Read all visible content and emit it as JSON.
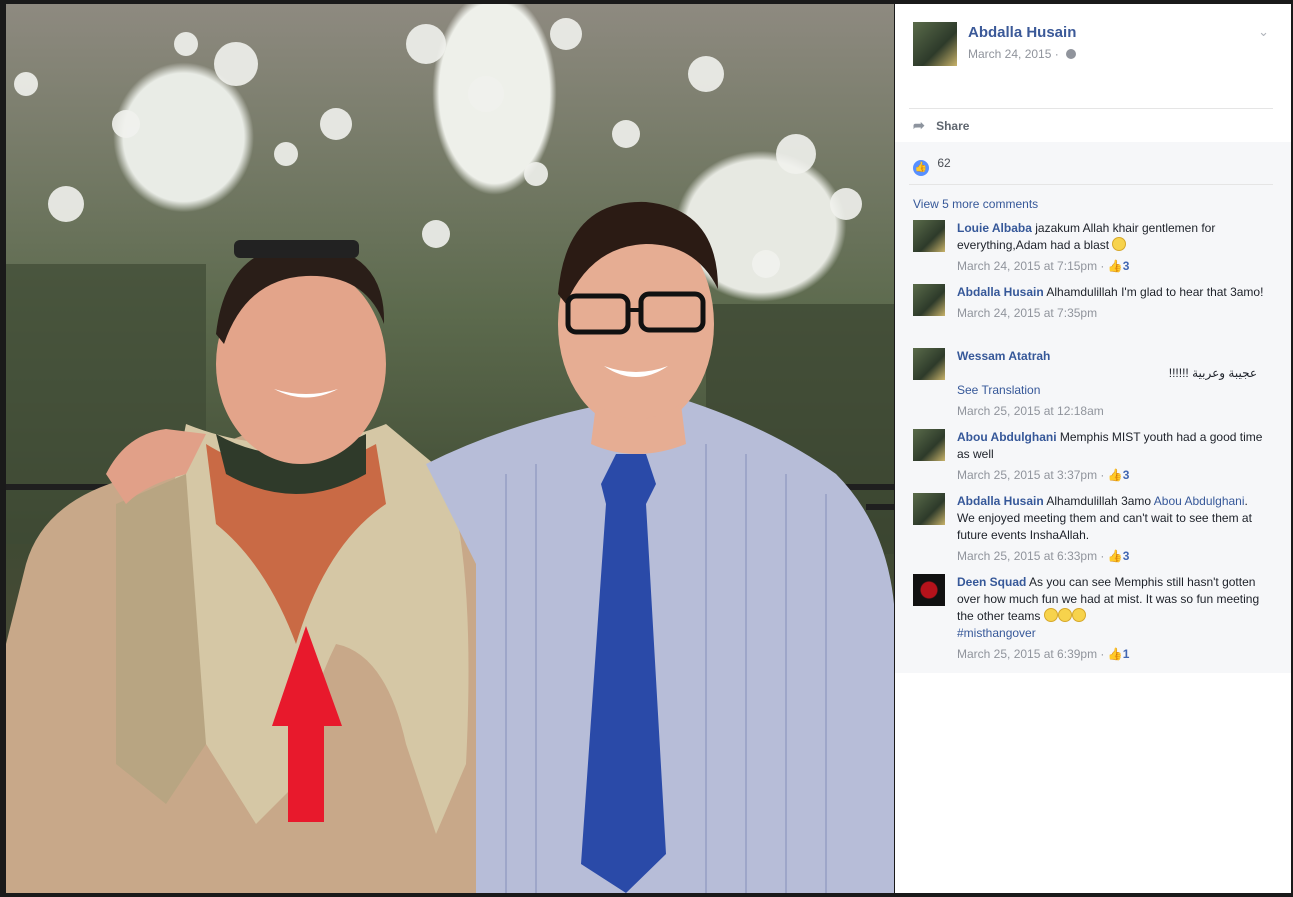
{
  "post": {
    "author": "Abdalla Husain",
    "date": "March 24, 2015 ·",
    "share_label": "Share",
    "like_count": "62",
    "view_more": "View 5 more comments"
  },
  "comments": [
    {
      "name": "Louie Albaba",
      "text": "jazakum Allah khair gentlemen for everything,Adam had a blast",
      "meta": "March 24, 2015 at 7:15pm ·",
      "likes": "3"
    },
    {
      "name": "Abdalla Husain",
      "text": "Alhamdulillah I'm glad to hear that 3amo!",
      "meta": "March 24, 2015 at 7:35pm",
      "likes": ""
    },
    {
      "name": "Wessam Atatrah",
      "text": "عجيبة وعربية !!!!!!",
      "see_translation": "See Translation",
      "meta": "March 25, 2015 at 12:18am",
      "likes": ""
    },
    {
      "name": "Abou Abdulghani",
      "text": "Memphis MIST youth had a good time as well",
      "meta": "March 25, 2015 at 3:37pm ·",
      "likes": "3"
    },
    {
      "name": "Abdalla Husain",
      "text": "Alhamdulillah 3amo",
      "mention": "Abou Abdulghani",
      "text2": ". We enjoyed meeting them and can't wait to see them at future events InshaAllah.",
      "meta": "March 25, 2015 at 6:33pm ·",
      "likes": "3"
    },
    {
      "name": "Deen Squad",
      "text": "As you can see Memphis still hasn't gotten over how much fun we had at mist. It was so fun meeting the other teams",
      "hashtag": "#misthangover",
      "meta": "March 25, 2015 at 6:39pm ·",
      "likes": "1"
    }
  ],
  "colors": {
    "link": "#365899",
    "meta": "#90949c",
    "arrow": "#e8192c",
    "panel_bg": "#f6f7f9"
  },
  "icons": [
    "chevron-down-icon",
    "globe-icon",
    "share-arrow-icon",
    "like-icon",
    "smile-emoji-icon",
    "red-arrow-annotation"
  ]
}
